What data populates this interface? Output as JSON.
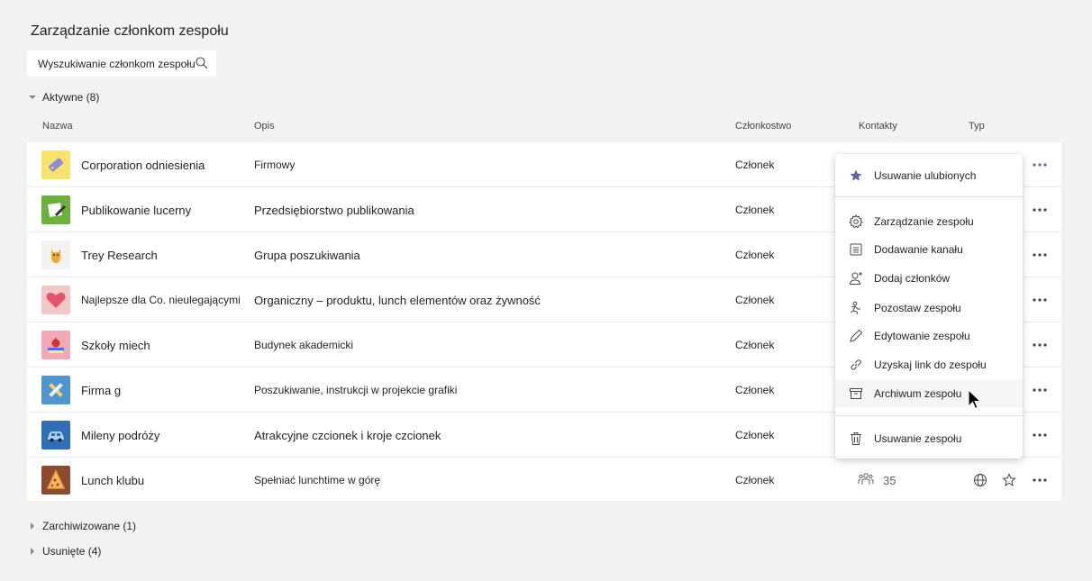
{
  "page": {
    "title": "Zarządzanie członkom zespołu",
    "search_placeholder": "Wyszukiwanie członkom zespołu"
  },
  "sections": {
    "active": "Aktywne (8)",
    "archived": "Zarchiwizowane (1)",
    "deleted": "Usunięte (4)"
  },
  "columns": {
    "name": "Nazwa",
    "description": "Opis",
    "membership": "Członkostwo",
    "contacts": "Kontakty",
    "type": "Typ"
  },
  "teams": [
    {
      "name": "Corporation odniesienia",
      "description": "Firmowy",
      "membership": "Członek",
      "avatar_icon": "tag-icon",
      "avatar_color": "#f9e36b"
    },
    {
      "name": "Publikowanie lucerny",
      "description": "Przedsiębiorstwo publikowania",
      "membership": "Członek",
      "avatar_icon": "paper-pen-icon",
      "avatar_color": "#6bb13b"
    },
    {
      "name": "Trey Research",
      "description": "Grupa poszukiwania",
      "membership": "Członek",
      "avatar_icon": "cat-icon",
      "avatar_color": "#f3f2f1"
    },
    {
      "name": "Najlepsze dla Co. nieulegającymi",
      "description": "Organiczny – produktu, lunch elementów oraz żywność",
      "membership": "Członek",
      "avatar_icon": "heart-icon",
      "avatar_color": "#f4c7c7"
    },
    {
      "name": "Szkoły miech",
      "description": "Budynek akademicki",
      "membership": "Członek",
      "avatar_icon": "apple-books-icon",
      "avatar_color": "#f2a9b4"
    },
    {
      "name": "Firma g",
      "description": "Poszukiwanie, instrukcji w projekcie grafiki",
      "membership": "Członek",
      "avatar_icon": "ruler-pencil-icon",
      "avatar_color": "#4f95d1"
    },
    {
      "name": "Mileny podróży",
      "description": "Atrakcyjne czcionek i kroje czcionek",
      "membership": "Członek",
      "avatar_icon": "car-icon",
      "avatar_color": "#2f6fb6"
    },
    {
      "name": "Lunch klubu",
      "description": "Spełniać lunchtime w górę",
      "membership": "Członek",
      "avatar_icon": "pizza-icon",
      "avatar_color": "#8c4a2f",
      "contacts_count": "35",
      "type_icon": "globe-icon"
    }
  ],
  "context_menu": {
    "remove_favorite": "Usuwanie ulubionych",
    "manage_team": "Zarządzanie zespołu",
    "add_channel": "Dodawanie kanału",
    "add_members": "Dodaj członków",
    "leave_team": "Pozostaw zespołu",
    "edit_team": "Edytowanie zespołu",
    "get_link": "Uzyskaj link do zespołu",
    "archive_team": "Archiwum zespołu",
    "delete_team": "Usuwanie zespołu"
  },
  "colors": {
    "accent": "#6264a7",
    "background": "#f3f2f1"
  }
}
